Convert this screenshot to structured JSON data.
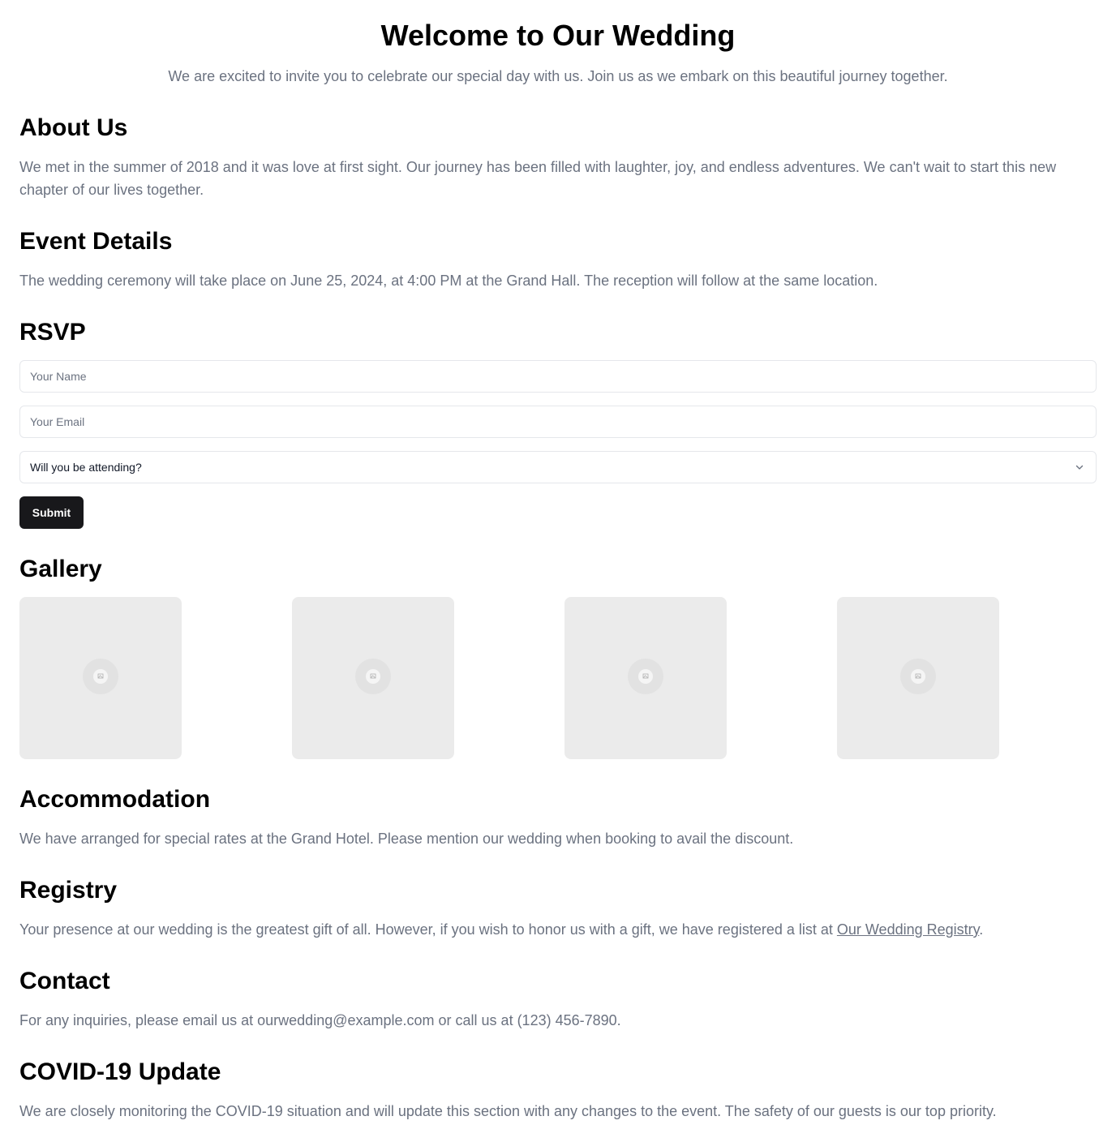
{
  "hero": {
    "title": "Welcome to Our Wedding",
    "subtitle": "We are excited to invite you to celebrate our special day with us. Join us as we embark on this beautiful journey together."
  },
  "about": {
    "title": "About Us",
    "text": "We met in the summer of 2018 and it was love at first sight. Our journey has been filled with laughter, joy, and endless adventures. We can't wait to start this new chapter of our lives together."
  },
  "event": {
    "title": "Event Details",
    "text": "The wedding ceremony will take place on June 25, 2024, at 4:00 PM at the Grand Hall. The reception will follow at the same location."
  },
  "rsvp": {
    "title": "RSVP",
    "name_placeholder": "Your Name",
    "name_value": "",
    "email_placeholder": "Your Email",
    "email_value": "",
    "attending_selected": "Will you be attending?",
    "submit_label": "Submit"
  },
  "gallery": {
    "title": "Gallery",
    "items": [
      {
        "icon": "image-placeholder-icon"
      },
      {
        "icon": "image-placeholder-icon"
      },
      {
        "icon": "image-placeholder-icon"
      },
      {
        "icon": "image-placeholder-icon"
      }
    ]
  },
  "accommodation": {
    "title": "Accommodation",
    "text": "We have arranged for special rates at the Grand Hotel. Please mention our wedding when booking to avail the discount."
  },
  "registry": {
    "title": "Registry",
    "text_before": "Your presence at our wedding is the greatest gift of all. However, if you wish to honor us with a gift, we have registered a list at ",
    "link_label": "Our Wedding Registry",
    "text_after": "."
  },
  "contact": {
    "title": "Contact",
    "text": "For any inquiries, please email us at ourwedding@example.com or call us at (123) 456-7890."
  },
  "covid": {
    "title": "COVID-19 Update",
    "text": "We are closely monitoring the COVID-19 situation and will update this section with any changes to the event. The safety of our guests is our top priority."
  },
  "colors": {
    "text_primary": "#000000",
    "text_muted": "#6b7280",
    "button_bg": "#18181b",
    "input_border": "#e5e7eb",
    "gallery_placeholder": "#ebebeb"
  }
}
